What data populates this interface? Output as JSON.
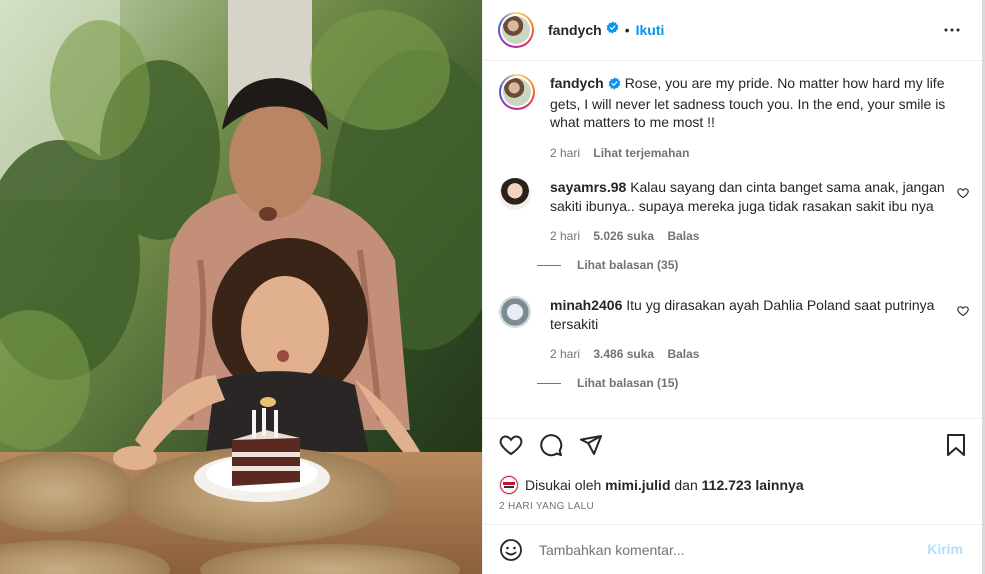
{
  "post": {
    "author": "fandych",
    "follow_label": "Ikuti",
    "separator": "•",
    "caption": {
      "username": "fandych",
      "text": "Rose, you are my pride. No matter how hard my life gets, I will never let sadness touch you. In the end, your smile is what matters to me most !!",
      "time": "2 hari",
      "translate_label": "Lihat terjemahan"
    },
    "comments": [
      {
        "username": "sayamrs.98",
        "text": "Kalau sayang dan cinta banget sama anak, jangan sakiti ibunya.. supaya mereka juga tidak rasakan sakit ibu nya",
        "time": "2 hari",
        "likes": "5.026 suka",
        "reply_label": "Balas",
        "view_replies": "Lihat balasan (35)"
      },
      {
        "username": "minah2406",
        "text": "Itu yg dirasakan ayah Dahlia Poland saat putrinya tersakiti",
        "time": "2 hari",
        "likes": "3.486 suka",
        "reply_label": "Balas",
        "view_replies": "Lihat balasan (15)"
      }
    ],
    "liked_by_prefix": "Disukai oleh",
    "liked_by_user": "mimi.julid",
    "liked_by_connector": "dan",
    "liked_by_count": "112.723 lainnya",
    "date": "2 HARI YANG LALU",
    "add_comment_placeholder": "Tambahkan komentar...",
    "post_label": "Kirim"
  },
  "icons": {
    "verified": "verified-badge-icon",
    "more": "more-options-icon",
    "like": "heart-icon",
    "comment": "comment-icon",
    "share": "share-icon",
    "save": "bookmark-icon",
    "emoji": "emoji-icon"
  },
  "colors": {
    "accent": "#0095f6",
    "post_disabled": "#b2dffc",
    "muted_text": "#737373"
  }
}
